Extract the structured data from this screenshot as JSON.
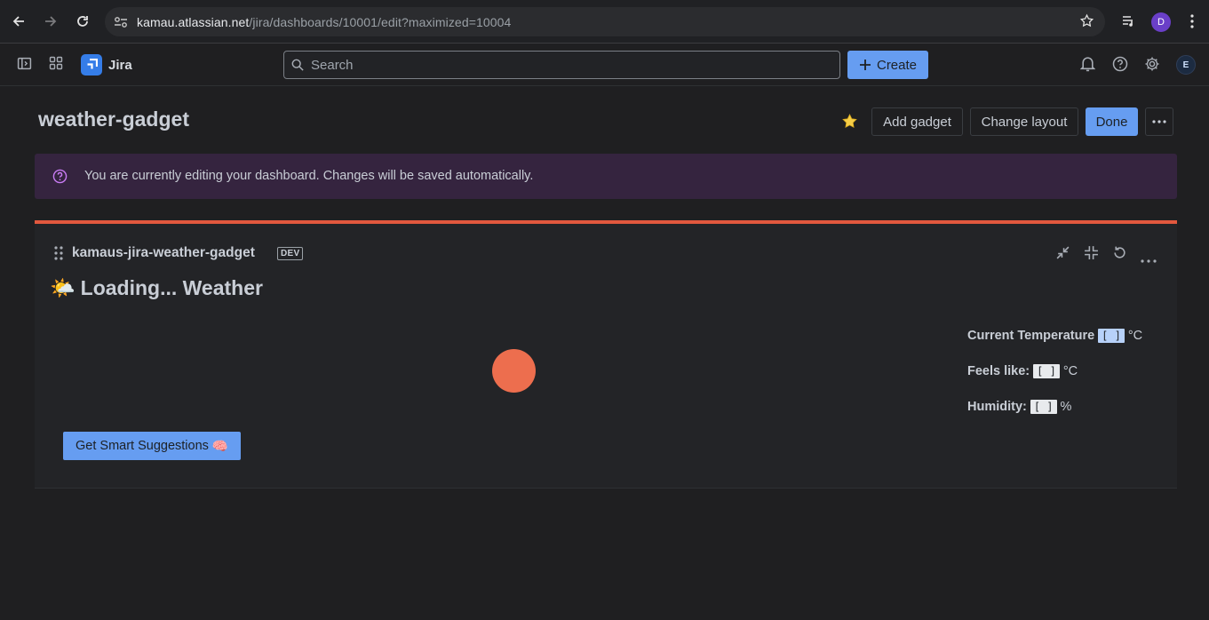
{
  "browser": {
    "url_host": "kamau.atlassian.net",
    "url_path": "/jira/dashboards/10001/edit?maximized=10004",
    "profile_initial": "D"
  },
  "nav": {
    "product_name": "Jira",
    "search_placeholder": "Search",
    "create_label": "Create",
    "user_initial": "E"
  },
  "page": {
    "title": "weather-gadget",
    "add_gadget_label": "Add gadget",
    "change_layout_label": "Change layout",
    "done_label": "Done"
  },
  "banner": {
    "message": "You are currently editing your dashboard. Changes will be saved automatically."
  },
  "gadget": {
    "title": "kamaus-jira-weather-gadget",
    "tag": "DEV",
    "weather_emoji": "🌤️",
    "heading": "Loading... Weather",
    "stats": {
      "current_label": "Current Temperature",
      "current_value": "[ ]",
      "current_unit": "°C",
      "feels_label": "Feels like:",
      "feels_value": "[ ]",
      "feels_unit": "°C",
      "humidity_label": "Humidity:",
      "humidity_value": "[ ]",
      "humidity_unit": "%"
    },
    "suggest_label": "Get Smart Suggestions",
    "suggest_emoji": "🧠"
  },
  "colors": {
    "accent": "#669df1",
    "gadget_border": "#e2583e",
    "loader": "#ed6e4e",
    "banner_bg": "#35243f"
  }
}
